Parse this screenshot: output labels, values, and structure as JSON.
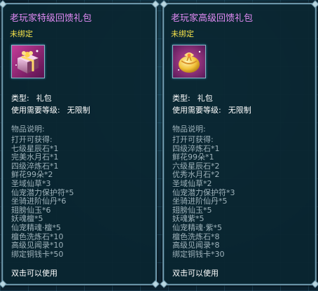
{
  "tooltips": [
    {
      "name": "老玩家特级回馈礼包",
      "bind_state": "未绑定",
      "type_label": "类型:",
      "type_value": "礼包",
      "level_label": "使用需要等级:",
      "level_value": "无限制",
      "desc_title": "物品说明:",
      "lines": [
        "打开可获得:",
        "七级星辰石*1",
        "完美水月石*1",
        "四级淬炼石*1",
        "鲜花99朵*2",
        "圣域仙草*3",
        "仙宠潜力保护符*5",
        "坐骑进阶仙丹*6",
        "翅膀仙玉*6",
        "妖魂檀*5",
        "仙宠精魂·檀*5",
        "檀色洗炼石*10",
        "高级见闻录*10",
        "绑定铜钱卡*50"
      ],
      "usage": "双击可以使用",
      "icon": "purple-gift-box-icon"
    },
    {
      "name": "老玩家高级回馈礼包",
      "bind_state": "未绑定",
      "type_label": "类型:",
      "type_value": "礼包",
      "level_label": "使用需要等级:",
      "level_value": "无限制",
      "desc_title": "物品说明:",
      "lines": [
        "打开可获得:",
        "四级淬炼石*1",
        "鲜花99朵*1",
        "六级星辰石*2",
        "优秀水月石*2",
        "圣域仙草*2",
        "仙宠潜力保护符*3",
        "坐骑进阶仙丹*5",
        "翅膀仙玉*5",
        "妖魂紫*5",
        "仙宠精魂·紫*5",
        "檀色洗炼石*8",
        "高级见闻录*8",
        "绑定铜钱卡*30"
      ],
      "usage": "双击可以使用",
      "icon": "golden-gift-pouch-icon"
    }
  ],
  "colors": {
    "name": "#e28bf5",
    "bind_state": "#f5e24a",
    "attribute": "#ffffff",
    "description": "#9fb3bb",
    "border": "#6a93a6"
  }
}
